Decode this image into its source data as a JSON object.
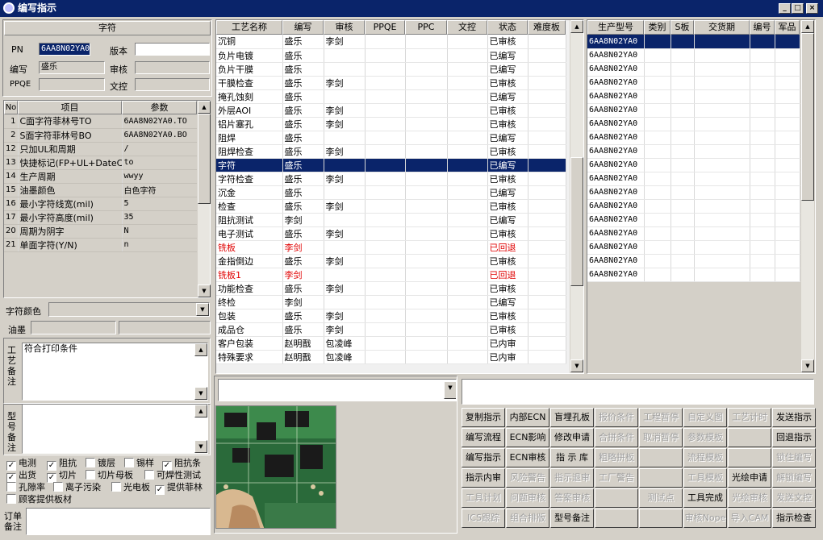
{
  "window": {
    "title": "编写指示"
  },
  "left": {
    "section_title": "字符",
    "fields": {
      "pn_label": "PN",
      "pn_value": "6AA8N02YA0",
      "version_label": "版本",
      "version_value": "",
      "writer_label": "编写",
      "writer_value": "盛乐",
      "review_label": "审核",
      "review_value": "",
      "ppqe_label": "PPQE",
      "ppqe_value": "",
      "control_label": "文控",
      "control_value": ""
    },
    "param_table": {
      "headers": [
        "No",
        "项目",
        "参数"
      ],
      "rows": [
        {
          "no": "1",
          "item": "C面字符菲林号TO",
          "param": "6AA8N02YA0.TO"
        },
        {
          "no": "2",
          "item": "S面字符菲林号BO",
          "param": "6AA8N02YA0.BO"
        },
        {
          "no": "12",
          "item": "只加UL和周期",
          "param": "/"
        },
        {
          "no": "13",
          "item": "快捷标记(FP+UL+DateCo",
          "param": "to"
        },
        {
          "no": "14",
          "item": "生产周期",
          "param": "wwyy"
        },
        {
          "no": "15",
          "item": "油墨颜色",
          "param": "白色字符"
        },
        {
          "no": "16",
          "item": "最小字符线宽(mil)",
          "param": "5"
        },
        {
          "no": "17",
          "item": "最小字符高度(mil)",
          "param": "35"
        },
        {
          "no": "20",
          "item": "周期为阴字",
          "param": "N"
        },
        {
          "no": "21",
          "item": "单面字符(Y/N)",
          "param": "n"
        }
      ]
    },
    "char_color_label": "字符颜色",
    "ink_label": "油墨",
    "process_note_label": "工艺备注",
    "process_note_value": "符合打印条件",
    "model_note_label": "型号备注",
    "checkboxes": [
      {
        "label": "电测",
        "checked": true
      },
      {
        "label": "阻抗",
        "checked": true
      },
      {
        "label": "镀层",
        "checked": false
      },
      {
        "label": "锡样",
        "checked": false
      },
      {
        "label": "阻抗条",
        "checked": true
      },
      {
        "label": "出货",
        "checked": true
      },
      {
        "label": "切片",
        "checked": true
      },
      {
        "label": "切片母板",
        "checked": false
      },
      {
        "label": "可焊性测试",
        "checked": false
      },
      {
        "label": "孔隙率",
        "checked": false
      },
      {
        "label": "离子污染",
        "checked": false
      },
      {
        "label": "光电板",
        "checked": false
      },
      {
        "label": "提供菲林",
        "checked": true
      },
      {
        "label": "顾客提供板材",
        "checked": false
      }
    ],
    "order_note_label": "订单备注"
  },
  "process_table": {
    "headers": [
      "工艺名称",
      "编写",
      "审核",
      "PPQE",
      "PPC",
      "文控",
      "状态",
      "难度板"
    ],
    "rows": [
      {
        "name": "沉铜",
        "writer": "盛乐",
        "reviewer": "李剑",
        "status": "已审核"
      },
      {
        "name": "负片电镀",
        "writer": "盛乐",
        "reviewer": "",
        "status": "已编写"
      },
      {
        "name": "负片干膜",
        "writer": "盛乐",
        "reviewer": "",
        "status": "已编写"
      },
      {
        "name": "干膜检查",
        "writer": "盛乐",
        "reviewer": "李剑",
        "status": "已审核"
      },
      {
        "name": "掩孔蚀刻",
        "writer": "盛乐",
        "reviewer": "",
        "status": "已编写"
      },
      {
        "name": "外层AOI",
        "writer": "盛乐",
        "reviewer": "李剑",
        "status": "已审核"
      },
      {
        "name": "铝片塞孔",
        "writer": "盛乐",
        "reviewer": "李剑",
        "status": "已审核"
      },
      {
        "name": "阻焊",
        "writer": "盛乐",
        "reviewer": "",
        "status": "已编写"
      },
      {
        "name": "阻焊检查",
        "writer": "盛乐",
        "reviewer": "李剑",
        "status": "已审核"
      },
      {
        "name": "字符",
        "writer": "盛乐",
        "reviewer": "",
        "status": "已编写"
      },
      {
        "name": "字符检查",
        "writer": "盛乐",
        "reviewer": "李剑",
        "status": "已审核"
      },
      {
        "name": "沉金",
        "writer": "盛乐",
        "reviewer": "",
        "status": "已编写"
      },
      {
        "name": "检查",
        "writer": "盛乐",
        "reviewer": "李剑",
        "status": "已审核"
      },
      {
        "name": "阻抗测试",
        "writer": "李剑",
        "reviewer": "",
        "status": "已编写"
      },
      {
        "name": "电子测试",
        "writer": "盛乐",
        "reviewer": "李剑",
        "status": "已审核"
      },
      {
        "name": "铣板",
        "writer": "李剑",
        "reviewer": "",
        "status": "已回退"
      },
      {
        "name": "金指倒边",
        "writer": "盛乐",
        "reviewer": "李剑",
        "status": "已审核"
      },
      {
        "name": "铣板1",
        "writer": "李剑",
        "reviewer": "",
        "status": "已回退"
      },
      {
        "name": "功能检查",
        "writer": "盛乐",
        "reviewer": "李剑",
        "status": "已审核"
      },
      {
        "name": "终检",
        "writer": "李剑",
        "reviewer": "",
        "status": "已编写"
      },
      {
        "name": "包装",
        "writer": "盛乐",
        "reviewer": "李剑",
        "status": "已审核"
      },
      {
        "name": "成品仓",
        "writer": "盛乐",
        "reviewer": "李剑",
        "status": "已审核"
      },
      {
        "name": "客户包装",
        "writer": "赵明戬",
        "reviewer": "包凌峰",
        "status": "已内审"
      },
      {
        "name": "特殊要求",
        "writer": "赵明戬",
        "reviewer": "包凌峰",
        "status": "已内审"
      }
    ],
    "selected_row": 9,
    "returned_status": "已回退"
  },
  "model_table": {
    "headers": [
      "生产型号",
      "类别",
      "S板",
      "交货期",
      "编号",
      "军品"
    ],
    "rows": [
      "6AA8N02YA0",
      "6AA8N02YA0",
      "6AA8N02YA0",
      "6AA8N02YA0",
      "6AA8N02YA0",
      "6AA8N02YA0",
      "6AA8N02YA0",
      "6AA8N02YA0",
      "6AA8N02YA0",
      "6AA8N02YA0",
      "6AA8N02YA0",
      "6AA8N02YA0",
      "6AA8N02YA0",
      "6AA8N02YA0",
      "6AA8N02YA0",
      "6AA8N02YA0",
      "6AA8N02YA0",
      "6AA8N02YA0"
    ]
  },
  "buttons": [
    [
      {
        "label": "复制指示",
        "enabled": true
      },
      {
        "label": "内部ECN",
        "enabled": true
      },
      {
        "label": "盲埋孔板",
        "enabled": true
      },
      {
        "label": "报价条件",
        "enabled": false
      },
      {
        "label": "工程暂停",
        "enabled": false
      },
      {
        "label": "自定义图",
        "enabled": false
      },
      {
        "label": "工艺计时",
        "enabled": false
      },
      {
        "label": "发送指示",
        "enabled": true
      }
    ],
    [
      {
        "label": "编写流程",
        "enabled": true
      },
      {
        "label": "ECN影响",
        "enabled": true
      },
      {
        "label": "修改申请",
        "enabled": true
      },
      {
        "label": "合拼条件",
        "enabled": false
      },
      {
        "label": "取消暂停",
        "enabled": false
      },
      {
        "label": "参数模板",
        "enabled": false
      },
      {
        "label": "",
        "enabled": false
      },
      {
        "label": "回退指示",
        "enabled": true
      }
    ],
    [
      {
        "label": "编写指示",
        "enabled": true
      },
      {
        "label": "ECN审核",
        "enabled": true
      },
      {
        "label": "指 示 库",
        "enabled": true
      },
      {
        "label": "粗略拼板",
        "enabled": false
      },
      {
        "label": "",
        "enabled": false
      },
      {
        "label": "流程模板",
        "enabled": false
      },
      {
        "label": "",
        "enabled": false
      },
      {
        "label": "锁住编写",
        "enabled": false
      }
    ],
    [
      {
        "label": "指示内审",
        "enabled": true
      },
      {
        "label": "风险警告",
        "enabled": false
      },
      {
        "label": "指示退审",
        "enabled": false
      },
      {
        "label": "工厂警告",
        "enabled": false
      },
      {
        "label": "",
        "enabled": false
      },
      {
        "label": "工具模板",
        "enabled": false
      },
      {
        "label": "光绘申请",
        "enabled": true
      },
      {
        "label": "解锁编写",
        "enabled": false
      }
    ],
    [
      {
        "label": "工具计划",
        "enabled": false
      },
      {
        "label": "问题审核",
        "enabled": false
      },
      {
        "label": "答案审核",
        "enabled": false
      },
      {
        "label": "",
        "enabled": false
      },
      {
        "label": "测试点",
        "enabled": false
      },
      {
        "label": "工具完成",
        "enabled": true
      },
      {
        "label": "光绘审核",
        "enabled": false
      },
      {
        "label": "发送文控",
        "enabled": false
      }
    ],
    [
      {
        "label": "ICS跟踪",
        "enabled": false
      },
      {
        "label": "组合排版",
        "enabled": false
      },
      {
        "label": "型号备注",
        "enabled": true
      },
      {
        "label": "",
        "enabled": false
      },
      {
        "label": "",
        "enabled": false
      },
      {
        "label": "审核Nope",
        "enabled": false
      },
      {
        "label": "导入CAM",
        "enabled": false
      },
      {
        "label": "指示检查",
        "enabled": true
      }
    ]
  ]
}
